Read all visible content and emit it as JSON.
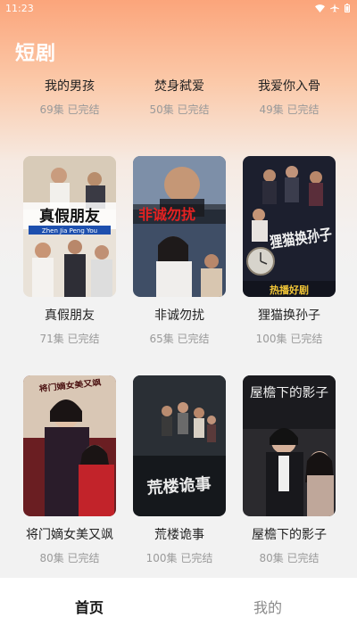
{
  "status_bar": {
    "time": "11:23"
  },
  "page_title": "短剧",
  "rows": [
    [
      {
        "title": "我的男孩",
        "episodes": "69集",
        "status": "已完结"
      },
      {
        "title": "焚身弑爱",
        "episodes": "50集",
        "status": "已完结"
      },
      {
        "title": "我爱你入骨",
        "episodes": "49集",
        "status": "已完结"
      }
    ],
    [
      {
        "title": "真假朋友",
        "episodes": "71集",
        "status": "已完结",
        "poster_text": "真假朋友",
        "poster_sub": "Zhen Jia Peng You"
      },
      {
        "title": "非诚勿扰",
        "episodes": "65集",
        "status": "已完结",
        "poster_text": "非诚勿扰"
      },
      {
        "title": "狸猫换孙子",
        "episodes": "100集",
        "status": "已完结",
        "poster_text": "狸猫换孙子",
        "poster_badge": "热播好剧"
      }
    ],
    [
      {
        "title": "将门嫡女美又飒",
        "episodes": "80集",
        "status": "已完结",
        "poster_text": "将门嫡女美又飒"
      },
      {
        "title": "荒楼诡事",
        "episodes": "100集",
        "status": "已完结",
        "poster_text": "荒楼诡事"
      },
      {
        "title": "屋檐下的影子",
        "episodes": "80集",
        "status": "已完结",
        "poster_text": "屋檐下的影子"
      }
    ]
  ],
  "bottom_nav": {
    "home": "首页",
    "mine": "我的"
  },
  "colors": {
    "accent_gradient_top": "#fba57b",
    "background": "#f2f2f2"
  }
}
